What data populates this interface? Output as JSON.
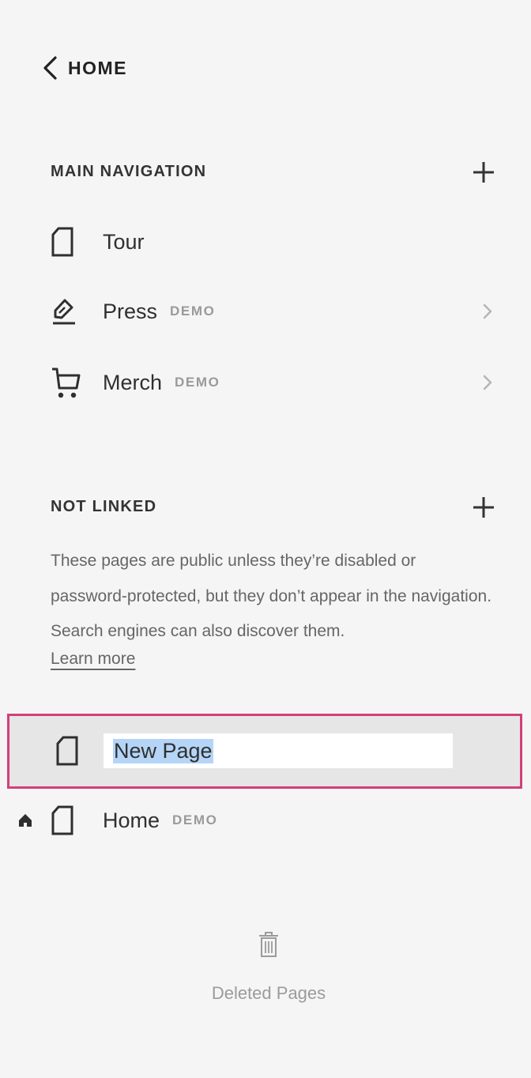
{
  "header": {
    "back_label": "HOME"
  },
  "main_navigation": {
    "title": "MAIN NAVIGATION",
    "items": [
      {
        "label": "Tour",
        "badge": "",
        "icon": "page-icon"
      },
      {
        "label": "Press",
        "badge": "DEMO",
        "icon": "pen-icon"
      },
      {
        "label": "Merch",
        "badge": "DEMO",
        "icon": "cart-icon"
      }
    ]
  },
  "not_linked": {
    "title": "NOT LINKED",
    "description": "These pages are public unless they’re disabled or password-protected, but they don’t appear in the navigation. Search engines can also discover them.",
    "learn_more": "Learn more",
    "new_page_value": "New Page",
    "home_item": {
      "label": "Home",
      "badge": "DEMO"
    }
  },
  "footer": {
    "deleted_pages_label": "Deleted Pages"
  },
  "colors": {
    "highlight_border": "#d33f79",
    "text_selection": "#b5d5f8"
  }
}
